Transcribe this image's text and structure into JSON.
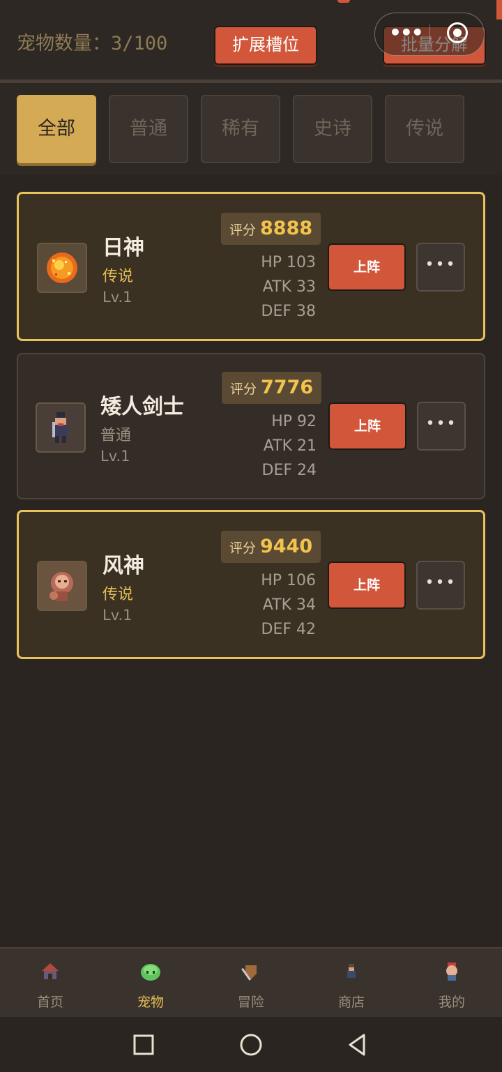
{
  "header": {
    "pet_count": "宠物数量：3/100",
    "expand_label": "扩展槽位",
    "batch_label": "批量分解"
  },
  "tabs": [
    "全部",
    "普通",
    "稀有",
    "史诗",
    "传说"
  ],
  "active_tab": "全部",
  "pets": [
    {
      "name": "日神",
      "rarity": "传说",
      "level": "Lv.1",
      "score_label": "评分",
      "score": "8888",
      "hp": "HP 103",
      "atk": "ATK 33",
      "def": "DEF 38",
      "deploy_label": "上阵",
      "more_label": "•••",
      "icon": "sun-orb-icon"
    },
    {
      "name": "矮人剑士",
      "rarity": "普通",
      "level": "Lv.1",
      "score_label": "评分",
      "score": "7776",
      "hp": "HP 92",
      "atk": "ATK 21",
      "def": "DEF 24",
      "deploy_label": "上阵",
      "more_label": "•••",
      "icon": "dwarf-swordsman-icon"
    },
    {
      "name": "风神",
      "rarity": "传说",
      "level": "Lv.1",
      "score_label": "评分",
      "score": "9440",
      "hp": "HP 106",
      "atk": "ATK 34",
      "def": "DEF 42",
      "deploy_label": "上阵",
      "more_label": "•••",
      "icon": "wind-god-icon"
    }
  ],
  "bottom_nav": [
    {
      "label": "首页",
      "icon": "house-icon"
    },
    {
      "label": "宠物",
      "icon": "slime-icon"
    },
    {
      "label": "冒险",
      "icon": "sword-shield-icon"
    },
    {
      "label": "商店",
      "icon": "merchant-icon"
    },
    {
      "label": "我的",
      "icon": "profile-icon"
    }
  ],
  "active_nav": "宠物",
  "colors": {
    "background": "#2b2521",
    "accent_gold": "#d4aa55",
    "accent_red": "#d2563a",
    "legend_border": "#e8c25a"
  }
}
